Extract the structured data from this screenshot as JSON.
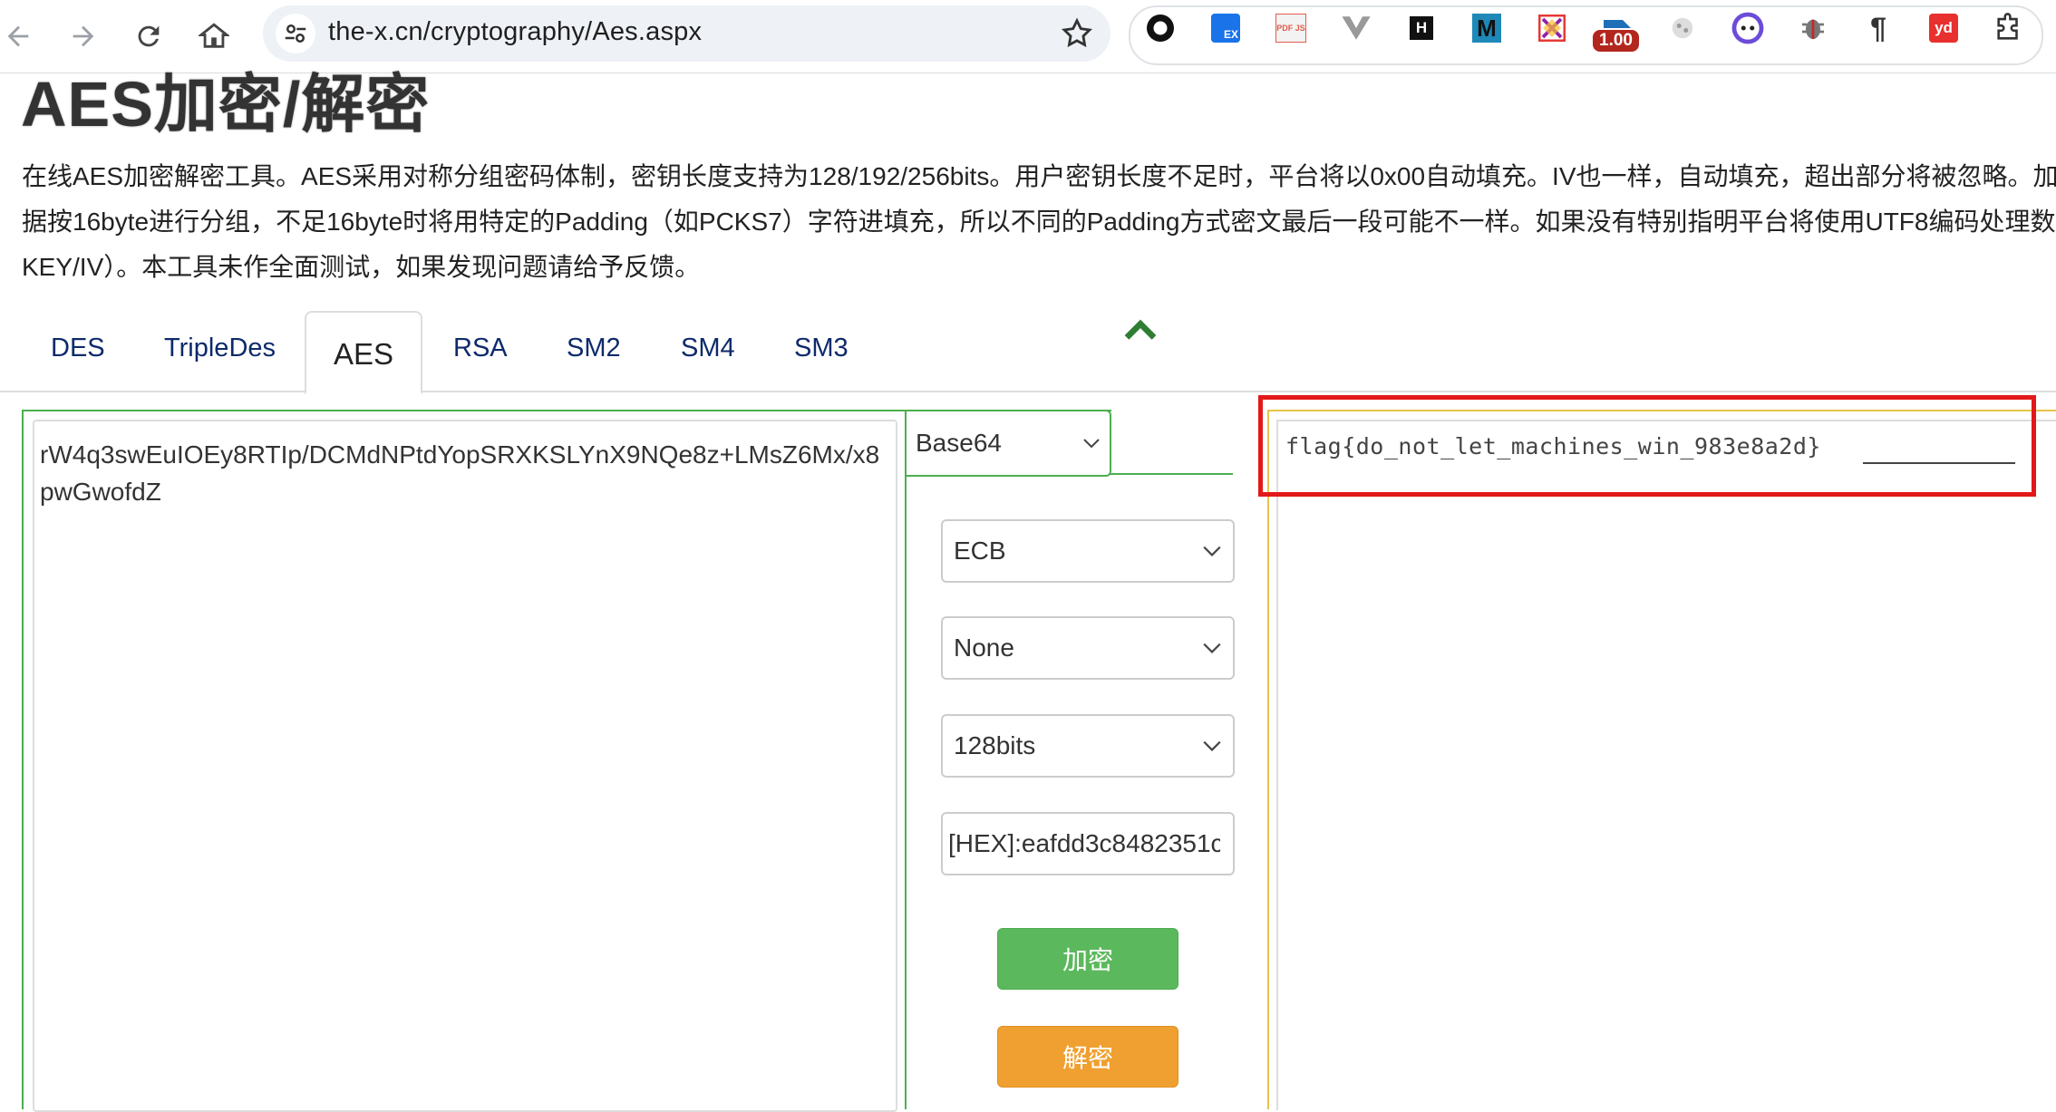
{
  "browser": {
    "url": "the-x.cn/cryptography/Aes.aspx",
    "ext_badge": "1.00",
    "extensions": [
      "circle-ext-icon",
      "translate-ext-icon",
      "pdfjs-ext-icon",
      "vue-devtools-icon",
      "h-ext-icon",
      "m-ext-icon",
      "colorful-ext-icon",
      "timer-ext-icon",
      "cookie-ext-icon",
      "face-ext-icon",
      "bug-ext-icon",
      "paragraph-ext-icon",
      "youdao-ext-icon",
      "puzzle-icon"
    ],
    "ext_labels": {
      "h": "H",
      "m": "M",
      "yd": "yd",
      "pdf": "PDF JS",
      "tr": "EX",
      "para": "¶"
    }
  },
  "page": {
    "title": "AES加密/解密",
    "desc_lines": [
      "在线AES加密解密工具。AES采用对称分组密码体制，密钥长度支持为128/192/256bits。用户密钥长度不足时，平台将以0x00自动填充。IV也一样，自动填充，超出部分将被忽略。加",
      "据按16byte进行分组，不足16byte时将用特定的Padding（如PCKS7）字符进填充，所以不同的Padding方式密文最后一段可能不一样。如果没有特别指明平台将使用UTF8编码处理数",
      "KEY/IV）。本工具未作全面测试，如果发现问题请给予反馈。"
    ]
  },
  "tabs": [
    "DES",
    "TripleDes",
    "AES",
    "RSA",
    "SM2",
    "SM4",
    "SM3"
  ],
  "active_tab": "AES",
  "input": {
    "text": "rW4q3swEuIOEy8RTIp/DCMdNPtdYopSRXKSLYnX9NQe8z+LMsZ6Mx/x8pwGwofdZ"
  },
  "options": {
    "format": "Base64",
    "mode": "ECB",
    "padding": "None",
    "key_size": "128bits",
    "key": "[HEX]:eafdd3c8482351c"
  },
  "buttons": {
    "encrypt": "加密",
    "decrypt": "解密"
  },
  "output": {
    "text": "flag{do_not_let_machines_win_983e8a2d}"
  },
  "colors": {
    "input_border": "#4caf50",
    "output_border": "#e8c44a",
    "highlight": "#e31919",
    "encrypt_btn": "#5cb85c",
    "decrypt_btn": "#f0a030",
    "tab_text": "#0d2a6b"
  }
}
